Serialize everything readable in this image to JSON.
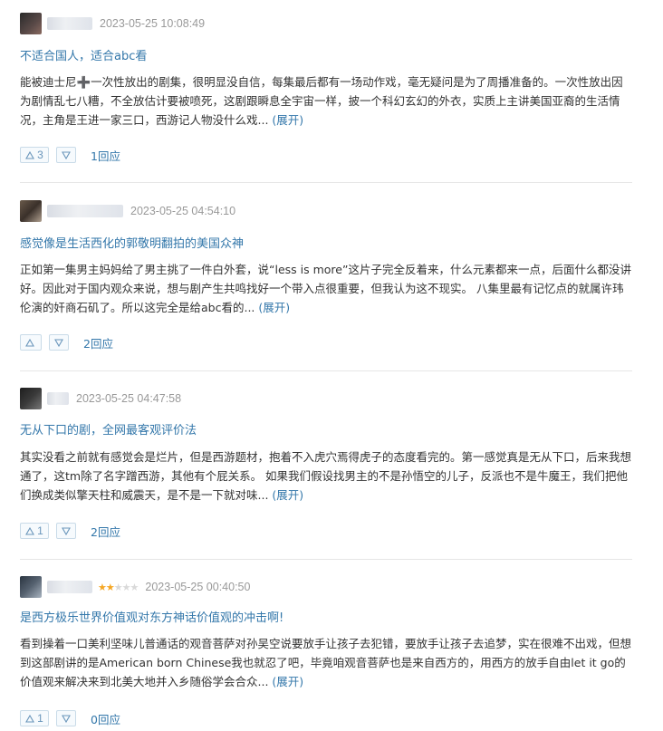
{
  "reviews": [
    {
      "date": "2023-05-25 10:08:49",
      "title": "不适合国人，适合abc看",
      "body": "能被迪士尼➕一次性放出的剧集，很明显没自信，每集最后都有一场动作戏，毫无疑问是为了周播准备的。一次性放出因为剧情乱七八糟，不全放估计要被喷死，这剧跟瞬息全宇宙一样，披一个科幻玄幻的外衣，实质上主讲美国亚裔的生活情况，主角是王进一家三口，西游记人物没什么戏...",
      "more": "(展开)",
      "up_count": "3",
      "reply": "1回应"
    },
    {
      "date": "2023-05-25 04:54:10",
      "title": "感觉像是生活西化的郭敬明翻拍的美国众神",
      "body": "正如第一集男主妈妈给了男主挑了一件白外套，说“less is more”这片子完全反着来，什么元素都来一点，后面什么都没讲好。因此对于国内观众来说，想与剧产生共鸣找好一个带入点很重要，但我认为这不现实。 八集里最有记忆点的就属许玮伦演的奸商石矶了。所以这完全是给abc看的...",
      "more": "(展开)",
      "up_count": "",
      "reply": "2回应"
    },
    {
      "date": "2023-05-25 04:47:58",
      "title": "无从下口的剧，全网最客观评价法",
      "body": "其实没看之前就有感觉会是烂片，但是西游题材，抱着不入虎穴焉得虎子的态度看完的。第一感觉真是无从下口，后来我想通了，这tm除了名字蹭西游，其他有个屁关系。 如果我们假设找男主的不是孙悟空的儿子，反派也不是牛魔王，我们把他们换成类似擎天柱和威震天，是不是一下就对味...",
      "more": "(展开)",
      "up_count": "1",
      "reply": "2回应"
    },
    {
      "date": "2023-05-25 00:40:50",
      "title": "是西方极乐世界价值观对东方神话价值观的冲击啊!",
      "body": "看到操着一口美利坚味儿普通话的观音菩萨对孙吴空说要放手让孩子去犯错，要放手让孩子去追梦，实在很难不出戏，但想到这部剧讲的是American born Chinese我也就忍了吧，毕竟咱观音菩萨也是来自西方的，用西方的放手自由let it go的价值观来解决来到北美大地并入乡随俗学会合众...",
      "more": "(展开)",
      "up_count": "1",
      "reply": "0回应",
      "rating": 2,
      "rating_max": 5
    }
  ],
  "icons": {
    "up": "triangle-up-icon",
    "down": "triangle-down-icon"
  },
  "colors": {
    "link": "#3377aa",
    "vote_border": "#c9dbe8",
    "star": "#f5a623"
  }
}
